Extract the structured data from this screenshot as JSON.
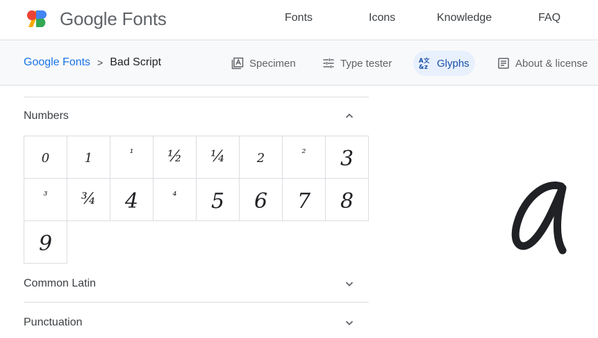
{
  "header": {
    "brand": "Google Fonts",
    "nav": [
      {
        "label": "Fonts"
      },
      {
        "label": "Icons"
      },
      {
        "label": "Knowledge"
      },
      {
        "label": "FAQ"
      }
    ]
  },
  "subheader": {
    "breadcrumb": {
      "root": "Google Fonts",
      "separator": ">",
      "current": "Bad Script"
    },
    "tabs": [
      {
        "label": "Specimen",
        "icon": "specimen-icon"
      },
      {
        "label": "Type tester",
        "icon": "tune-icon"
      },
      {
        "label": "Glyphs",
        "icon": "glyphs-icon",
        "active": true
      },
      {
        "label": "About & license",
        "icon": "article-icon"
      }
    ]
  },
  "sections": {
    "numbers": {
      "title": "Numbers",
      "expanded": true
    },
    "common_latin": {
      "title": "Common Latin",
      "expanded": false
    },
    "punctuation": {
      "title": "Punctuation",
      "expanded": false
    }
  },
  "glyphs": [
    "0",
    "1",
    "¹",
    "½",
    "¼",
    "2",
    "²",
    "3",
    "³",
    "¾",
    "4",
    "⁴",
    "5",
    "6",
    "7",
    "8",
    "9"
  ],
  "preview_glyph": "a",
  "colors": {
    "accent": "#1a73e8",
    "active_tab_bg": "#e8f0fe",
    "border": "#dadce0"
  }
}
